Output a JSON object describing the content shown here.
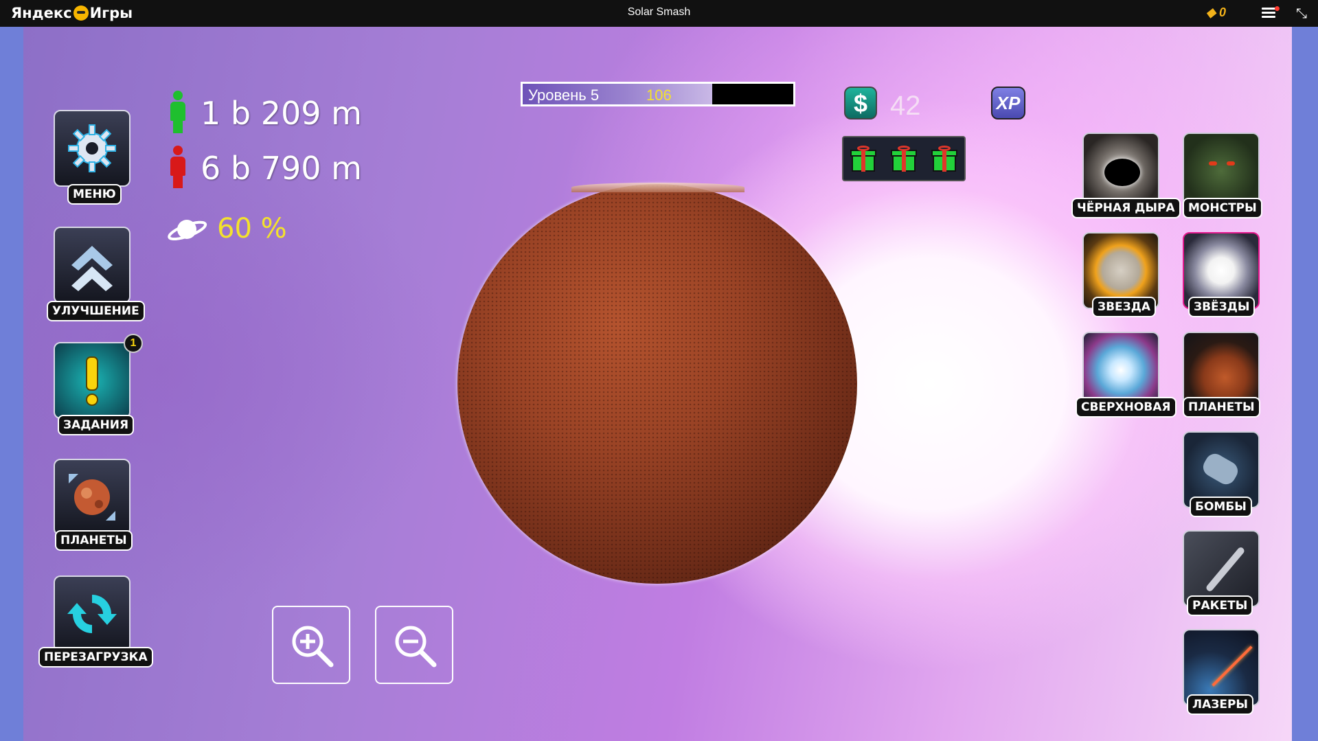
{
  "topbar": {
    "brand_left": "Яндекс",
    "brand_right": "Игры",
    "title": "Solar Smash",
    "coins": "0"
  },
  "left_menu": [
    {
      "label": "МЕНЮ",
      "icon": "gear-icon"
    },
    {
      "label": "УЛУЧШЕНИЕ",
      "icon": "upgrade-chevron-icon"
    },
    {
      "label": "ЗАДАНИЯ",
      "icon": "quest-exclamation-icon",
      "badge": "1"
    },
    {
      "label": "ПЛАНЕТЫ",
      "icon": "planet-select-icon"
    },
    {
      "label": "ПЕРЕЗАГРУЗКА",
      "icon": "reload-icon"
    }
  ],
  "stats": {
    "alive": "1 b 209 m",
    "dead": "6 b 790 m",
    "planet_health": "60 %"
  },
  "level": {
    "label": "Уровень  5",
    "xp": "106",
    "progress_fraction": 0.7
  },
  "currency": {
    "money_symbol": "$",
    "money": "42",
    "xp_label": "XP"
  },
  "weapons": [
    {
      "label": "ЧЁРНАЯ ДЫРА",
      "icon": "black-hole-icon"
    },
    {
      "label": "МОНСТРЫ",
      "icon": "monster-icon"
    },
    {
      "label": "ЗВЕЗДА",
      "icon": "star-icon"
    },
    {
      "label": "ЗВЁЗДЫ",
      "icon": "stars-icon"
    },
    {
      "label": "СВЕРХНОВАЯ",
      "icon": "supernova-icon"
    },
    {
      "label": "ПЛАНЕТЫ",
      "icon": "planet-crash-icon"
    },
    {
      "label": "БОМБЫ",
      "icon": "bomb-icon"
    },
    {
      "label": "РАКЕТЫ",
      "icon": "missile-icon"
    },
    {
      "label": "ЛАЗЕРЫ",
      "icon": "laser-icon"
    }
  ],
  "colors": {
    "alive": "#1fbf2e",
    "dead": "#d81919",
    "accent_yellow": "#f4e22c",
    "stars_highlight": "#e6188e"
  }
}
